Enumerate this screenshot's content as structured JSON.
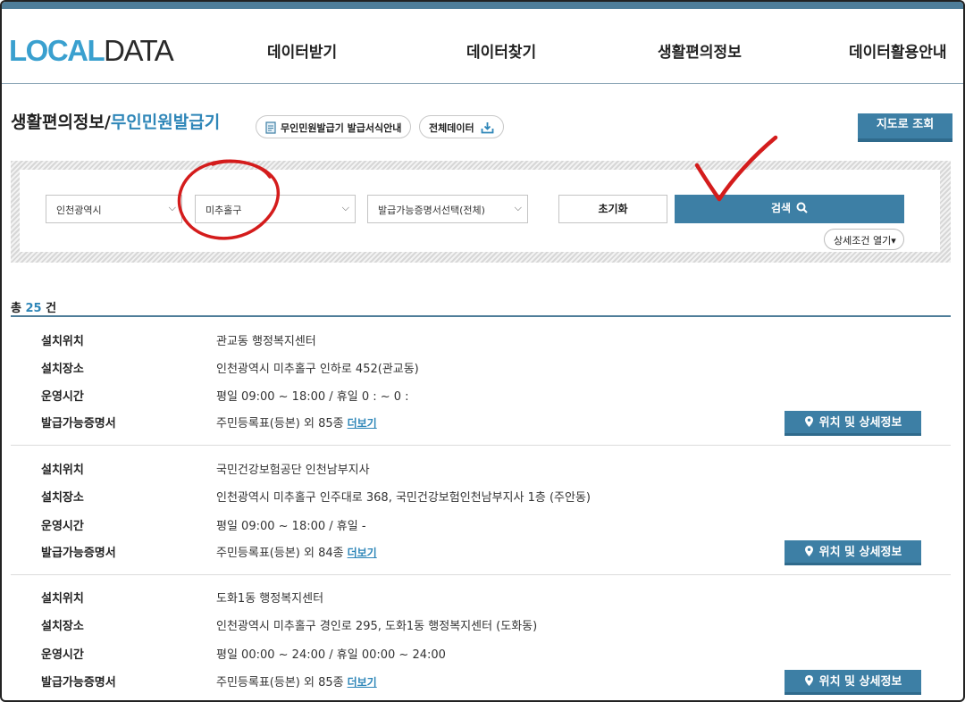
{
  "header": {
    "logo_part1": "LOCAL",
    "logo_part2": "DATA",
    "nav": [
      "데이터받기",
      "데이터찾기",
      "생활편의정보",
      "데이터활용안내"
    ]
  },
  "page": {
    "title_prefix": "생활편의정보/",
    "title_accent": "무인민원발급기",
    "guide_button": "무인민원발급기 발급서식안내",
    "all_data_button": "전체데이터",
    "map_button": "지도로 조회"
  },
  "search": {
    "city": "인천광역시",
    "district": "미추홀구",
    "certificate": "발급가능증명서선택(전체)",
    "reset_label": "초기화",
    "search_label": "검색",
    "detail_label": "상세조건 열기"
  },
  "results": {
    "count_prefix": "총 ",
    "count": "25",
    "count_suffix": " 건",
    "labels": {
      "location": "설치위치",
      "place": "설치장소",
      "hours": "운영시간",
      "certs": "발급가능증명서"
    },
    "more_label": "더보기",
    "loc_button": "위치 및 상세정보",
    "items": [
      {
        "location": "관교동 행정복지센터",
        "place": "인천광역시 미추홀구 인하로 452(관교동)",
        "hours": "평일 09:00 ~ 18:00 / 휴일 0 : ~ 0 :",
        "certs": "주민등록표(등본) 외 85종"
      },
      {
        "location": "국민건강보험공단 인천남부지사",
        "place": "인천광역시 미추홀구 인주대로 368, 국민건강보험인천남부지사 1층 (주안동)",
        "hours": "평일 09:00 ~ 18:00 / 휴일 -",
        "certs": "주민등록표(등본) 외 84종"
      },
      {
        "location": "도화1동 행정복지센터",
        "place": "인천광역시 미추홀구 경인로 295, 도화1동 행정복지센터 (도화동)",
        "hours": "평일 00:00 ~ 24:00 / 휴일 00:00 ~ 24:00",
        "certs": "주민등록표(등본) 외 85종"
      }
    ]
  },
  "colors": {
    "accent": "#2e86b8",
    "button": "#3d7fa5",
    "annotation": "#d41c1c"
  },
  "icons": {
    "document": "document-icon",
    "download": "download-icon",
    "search": "search-icon",
    "pin": "location-pin-icon",
    "chevron": "chevron-down-icon"
  }
}
